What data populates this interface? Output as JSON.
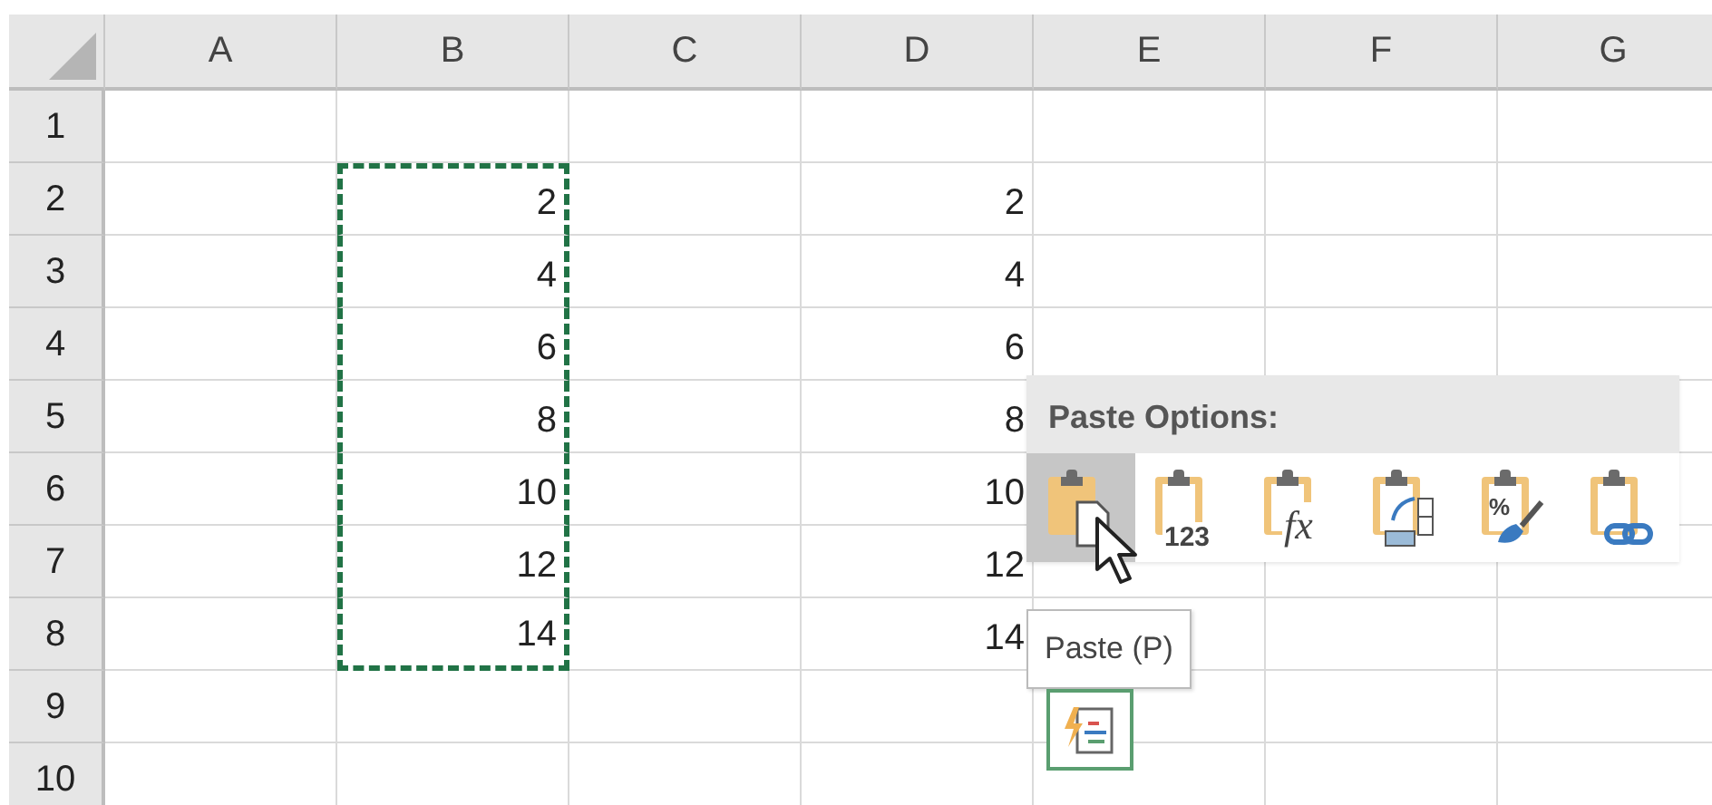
{
  "columns": [
    "A",
    "B",
    "C",
    "D",
    "E",
    "F",
    "G"
  ],
  "rows": [
    {
      "label": "1",
      "cells": [
        null,
        null,
        null,
        null,
        null,
        null,
        null
      ]
    },
    {
      "label": "2",
      "cells": [
        null,
        {
          "value": "2",
          "copied": true
        },
        null,
        {
          "value": "2",
          "copied": false
        },
        null,
        null,
        null
      ]
    },
    {
      "label": "3",
      "cells": [
        null,
        {
          "value": "4",
          "copied": true
        },
        null,
        {
          "value": "4",
          "copied": false
        },
        null,
        null,
        null
      ]
    },
    {
      "label": "4",
      "cells": [
        null,
        {
          "value": "6",
          "copied": true
        },
        null,
        {
          "value": "6",
          "copied": false
        },
        null,
        null,
        null
      ]
    },
    {
      "label": "5",
      "cells": [
        null,
        {
          "value": "8",
          "copied": true
        },
        null,
        {
          "value": "8",
          "copied": false
        },
        null,
        null,
        null
      ]
    },
    {
      "label": "6",
      "cells": [
        null,
        {
          "value": "10",
          "copied": true
        },
        null,
        {
          "value": "10",
          "copied": false
        },
        null,
        null,
        null
      ]
    },
    {
      "label": "7",
      "cells": [
        null,
        {
          "value": "12",
          "copied": true
        },
        null,
        {
          "value": "12",
          "copied": false
        },
        null,
        null,
        null
      ]
    },
    {
      "label": "8",
      "cells": [
        null,
        {
          "value": "14",
          "copied": true
        },
        null,
        {
          "value": "14",
          "copied": false
        },
        null,
        null,
        null
      ]
    },
    {
      "label": "9",
      "cells": [
        null,
        null,
        null,
        null,
        null,
        null,
        null
      ]
    },
    {
      "label": "10",
      "cells": [
        null,
        null,
        null,
        null,
        null,
        null,
        null
      ]
    }
  ],
  "paste_options": {
    "title": "Paste Options:",
    "options": [
      {
        "kind": "paste",
        "selected": true
      },
      {
        "kind": "values",
        "selected": false,
        "icon_text": "123"
      },
      {
        "kind": "formulas",
        "selected": false,
        "icon_text": "fx"
      },
      {
        "kind": "transpose",
        "selected": false
      },
      {
        "kind": "formatting",
        "selected": false,
        "icon_text": "%"
      },
      {
        "kind": "link",
        "selected": false
      }
    ],
    "tooltip": "Paste (P)"
  }
}
